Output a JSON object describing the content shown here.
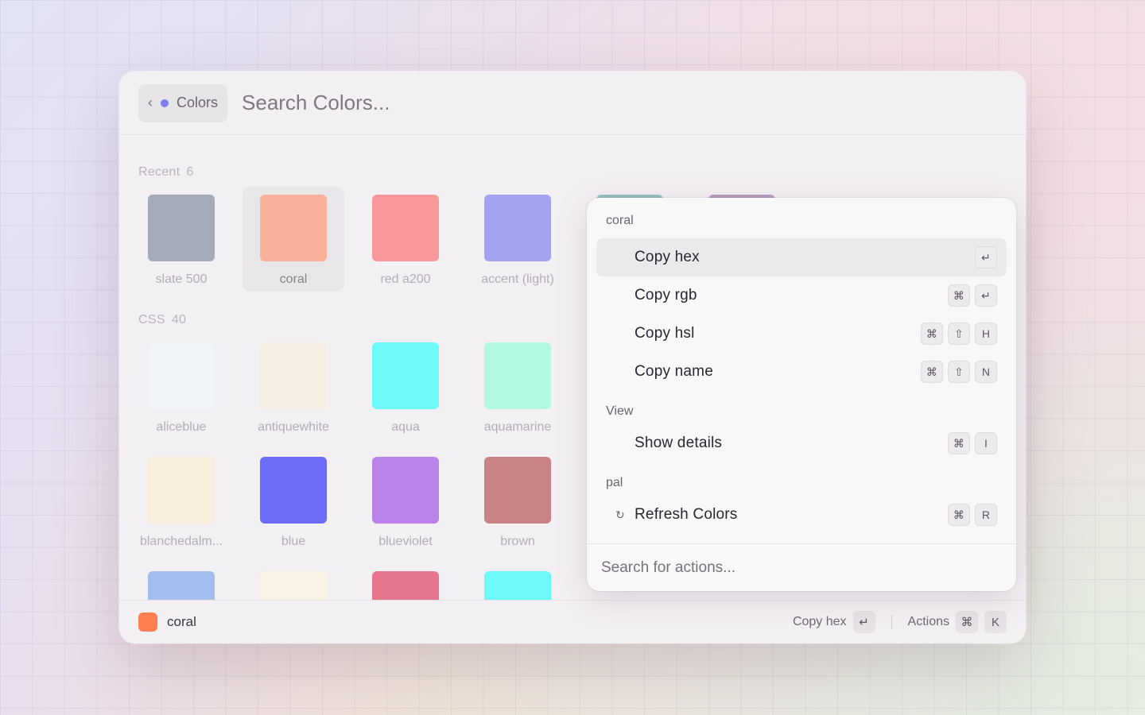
{
  "header": {
    "back_chip_label": "Colors",
    "back_chip_dot_color": "#7f7ef0",
    "search_placeholder": "Search Colors..."
  },
  "sections": {
    "recent": {
      "title": "Recent",
      "count": "6",
      "items": [
        {
          "label": "slate 500",
          "color": "#64748b"
        },
        {
          "label": "coral",
          "color": "#ff7f50",
          "selected": true
        },
        {
          "label": "red a200",
          "color": "#ff5252"
        },
        {
          "label": "accent (light)",
          "color": "#6366f1"
        },
        {
          "label": "",
          "color": "#4b9a9a"
        },
        {
          "label": "",
          "color": "#8b5a9a"
        }
      ]
    },
    "css": {
      "title": "CSS",
      "count": "40",
      "items": [
        {
          "label": "aliceblue",
          "color": "#f0f8ff"
        },
        {
          "label": "antiquewhite",
          "color": "#faebd7"
        },
        {
          "label": "aqua",
          "color": "#00ffff"
        },
        {
          "label": "aquamarine",
          "color": "#7fffd4"
        },
        {
          "label": "blanchedalm...",
          "color": "#ffebcd"
        },
        {
          "label": "blue",
          "color": "#0000ff"
        },
        {
          "label": "blueviolet",
          "color": "#8a2be2"
        },
        {
          "label": "brown",
          "color": "#a52a2a"
        },
        {
          "label": "",
          "color": "#6495ed"
        },
        {
          "label": "",
          "color": "#fff8dc"
        },
        {
          "label": "",
          "color": "#dc143c"
        },
        {
          "label": "",
          "color": "#00ffff"
        }
      ]
    }
  },
  "footer": {
    "selected_name": "coral",
    "selected_color": "#ff7f50",
    "primary_action": "Copy hex",
    "primary_key": "↵",
    "actions_label": "Actions",
    "actions_keys": [
      "⌘",
      "K"
    ]
  },
  "action_menu": {
    "groups": [
      {
        "title": "coral",
        "items": [
          {
            "label": "Copy hex",
            "keys": [
              "↵"
            ],
            "active": true
          },
          {
            "label": "Copy rgb",
            "keys": [
              "⌘",
              "↵"
            ]
          },
          {
            "label": "Copy hsl",
            "keys": [
              "⌘",
              "⇧",
              "H"
            ]
          },
          {
            "label": "Copy name",
            "keys": [
              "⌘",
              "⇧",
              "N"
            ]
          }
        ]
      },
      {
        "title": "View",
        "items": [
          {
            "label": "Show details",
            "keys": [
              "⌘",
              "I"
            ]
          }
        ]
      },
      {
        "title": "pal",
        "items": [
          {
            "label": "Refresh Colors",
            "keys": [
              "⌘",
              "R"
            ],
            "icon": "refresh-icon",
            "icon_glyph": "↻"
          }
        ]
      }
    ],
    "search_placeholder": "Search for actions..."
  }
}
